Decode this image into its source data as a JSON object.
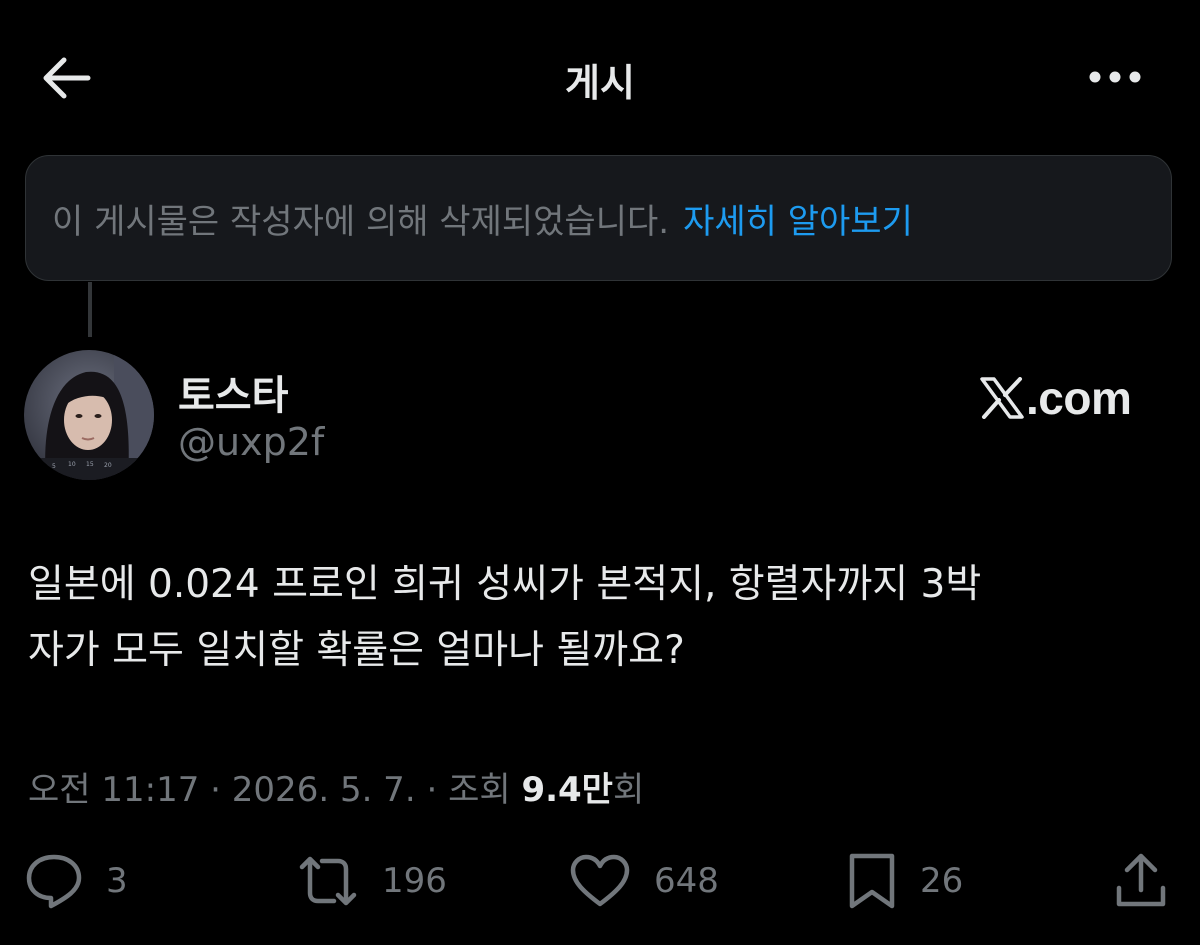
{
  "header": {
    "back_icon": "arrow-left-icon",
    "title": "게시",
    "more_icon": "more-horizontal-icon"
  },
  "deleted_notice": {
    "text": "이 게시물은 작성자에 의해 삭제되었습니다.",
    "link": "자세히 알아보기"
  },
  "post": {
    "author": {
      "display_name": "토스타",
      "handle": "@uxp2f",
      "avatar": "profile-photo"
    },
    "brand": {
      "logo": "x-logo",
      "text": ".com"
    },
    "body_lines": [
      "일본에 0.024 프로인 희귀 성씨가 본적지, 항렬자까지 3박",
      "자가 모두 일치할 확률은 얼마나 될까요?"
    ],
    "meta": {
      "time": "오전 11:17",
      "separator": "·",
      "date": "2026. 5. 7.",
      "views_label": "조회",
      "views_value": "9.4만",
      "views_suffix": "회"
    },
    "actions": {
      "reply": {
        "icon": "reply-icon",
        "count": "3"
      },
      "repost": {
        "icon": "repost-icon",
        "count": "196"
      },
      "like": {
        "icon": "heart-icon",
        "count": "648"
      },
      "bookmark": {
        "icon": "bookmark-icon",
        "count": "26"
      },
      "share": {
        "icon": "share-icon"
      }
    }
  },
  "colors": {
    "background": "#000000",
    "primary_text": "#e7e9ea",
    "secondary_text": "#71767b",
    "link": "#1d9bf0",
    "notice_bg": "#16181c",
    "border": "#2f3336"
  }
}
